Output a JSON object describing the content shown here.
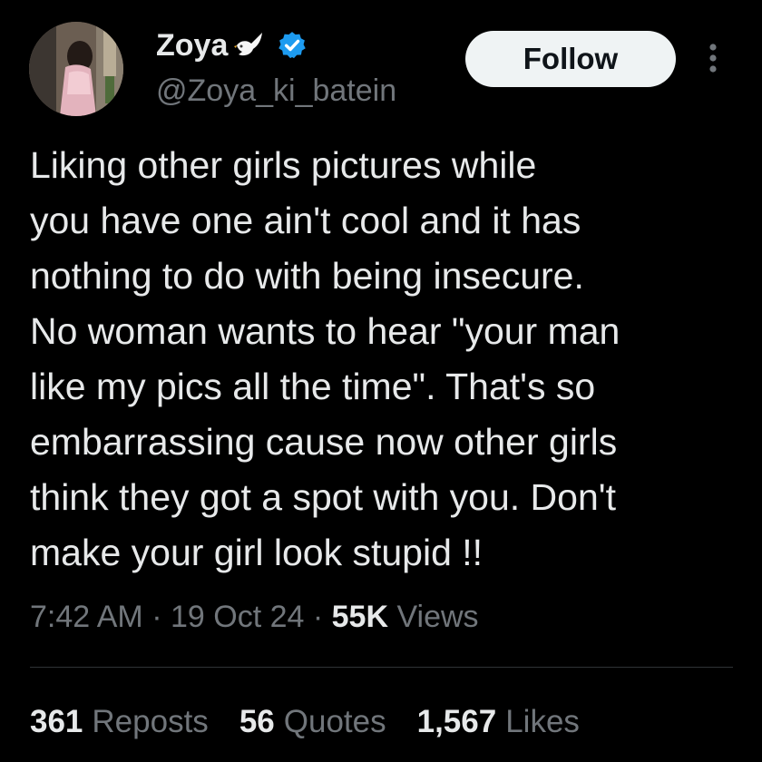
{
  "author": {
    "display_name": "Zoya",
    "handle": "@Zoya_ki_batein",
    "avatar_icon": "profile-photo",
    "name_emoji_icon": "dove-icon",
    "verified_icon": "verified-badge-icon",
    "verified_color": "#1d9bf0"
  },
  "actions": {
    "follow_label": "Follow",
    "more_icon": "more-options-icon"
  },
  "tweet": {
    "text": "Liking other girls pictures while\nyou have one ain't cool and it has\nnothing to do with being insecure.\nNo woman wants to hear \"your man\nlike my pics all the time\". That's so\nembarrassing cause now other girls\nthink they got a spot with you. Don't\nmake your girl look stupid !!",
    "time": "7:42 AM",
    "separator": "·",
    "date": "19 Oct 24",
    "views_count": "55K",
    "views_label": "Views"
  },
  "stats": {
    "reposts_count": "361",
    "reposts_label": "Reposts",
    "quotes_count": "56",
    "quotes_label": "Quotes",
    "likes_count": "1,567",
    "likes_label": "Likes"
  },
  "colors": {
    "background": "#000000",
    "text_primary": "#e7e9ea",
    "text_secondary": "#71767b",
    "divider": "#2f3336",
    "follow_bg": "#eff3f4"
  }
}
